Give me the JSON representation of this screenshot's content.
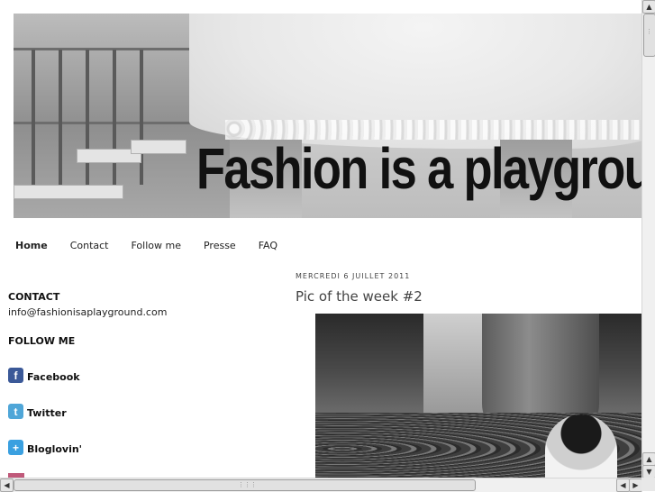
{
  "header": {
    "title": "Fashion is a playground"
  },
  "nav": {
    "items": [
      "Home",
      "Contact",
      "Follow me",
      "Presse",
      "FAQ"
    ],
    "active": "Home"
  },
  "sidebar": {
    "contact": {
      "title": "CONTACT",
      "email": "info@fashionisaplayground.com"
    },
    "follow": {
      "title": "FOLLOW ME",
      "links": [
        {
          "label": "Facebook",
          "icon": "facebook-icon",
          "color": "#3b5998",
          "glyph": "f"
        },
        {
          "label": "Twitter",
          "icon": "twitter-icon",
          "color": "#4fa6d8",
          "glyph": "t"
        },
        {
          "label": "Bloglovin'",
          "icon": "bloglovin-icon",
          "color": "#3aa0e0",
          "glyph": "+"
        }
      ]
    }
  },
  "post": {
    "date": "MERCREDI 6 JUILLET 2011",
    "title": "Pic of the week #2"
  },
  "colors": {
    "page_bg": "#ffffff",
    "text": "#222222",
    "post_title": "#444444",
    "scrollbar": "#f0f0f0"
  }
}
